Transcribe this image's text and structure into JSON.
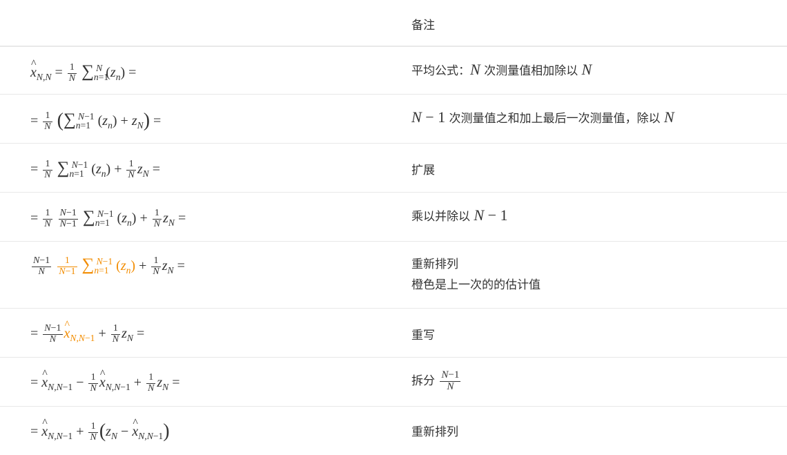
{
  "header": {
    "note_title": "备注"
  },
  "rows": [
    {
      "note": "平均公式：",
      "note_mid": " 次测量值相加除以 ",
      "var_N": "N"
    },
    {
      "note_a": " 次测量值之和加上最后一次测量值，除以 ",
      "var_N": "N",
      "num_minus": "− 1"
    },
    {
      "note": "扩展"
    },
    {
      "note": "乘以并除以 ",
      "var_N": "N",
      "num_minus": " − 1"
    },
    {
      "note_line1": "重新排列",
      "note_line2": "橙色是上一次的的估计值"
    },
    {
      "note": "重写"
    },
    {
      "note": "拆分 "
    },
    {
      "note": "重新排列"
    }
  ],
  "colors": {
    "highlight": "#f28c00",
    "divider": "#e8e8e8",
    "text": "#333333"
  }
}
